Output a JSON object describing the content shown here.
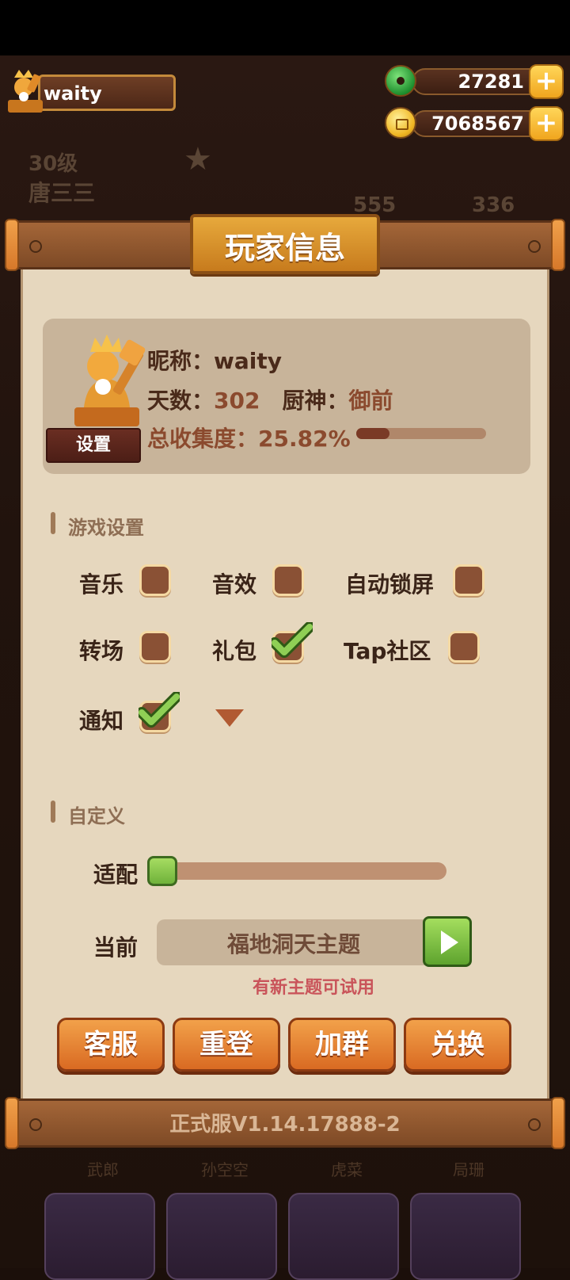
{
  "hud": {
    "player_name": "waity",
    "level": "30级",
    "player_title": "唐三三",
    "gems": "27281",
    "coins": "7068567",
    "stat_a": "555",
    "stat_b": "336",
    "bg_chars": [
      "武郎",
      "孙空空",
      "虎菜",
      "局珊"
    ]
  },
  "modal": {
    "title": "玩家信息",
    "settings_button": "设置",
    "nickname_label": "昵称：",
    "nickname": "waity",
    "days_label": "天数：",
    "days": "302",
    "chef_label": "厨神：",
    "chef": "御前",
    "collection_label": "总收集度：",
    "collection": "25.82%",
    "collection_fraction": 0.2582
  },
  "game_settings": {
    "title": "游戏设置",
    "options": [
      {
        "label": "音乐",
        "checked": false
      },
      {
        "label": "音效",
        "checked": false
      },
      {
        "label": "自动锁屏",
        "checked": false
      },
      {
        "label": "转场",
        "checked": false
      },
      {
        "label": "礼包",
        "checked": true
      },
      {
        "label": "Tap社区",
        "checked": false
      },
      {
        "label": "通知",
        "checked": true
      }
    ]
  },
  "custom": {
    "title": "自定义",
    "adapt_label": "适配",
    "adapt_value": 0.0,
    "current_label": "当前",
    "theme": "福地洞天主题",
    "hint": "有新主题可试用"
  },
  "actions": [
    "客服",
    "重登",
    "加群",
    "兑换"
  ],
  "version": "正式服V1.14.17888-2"
}
